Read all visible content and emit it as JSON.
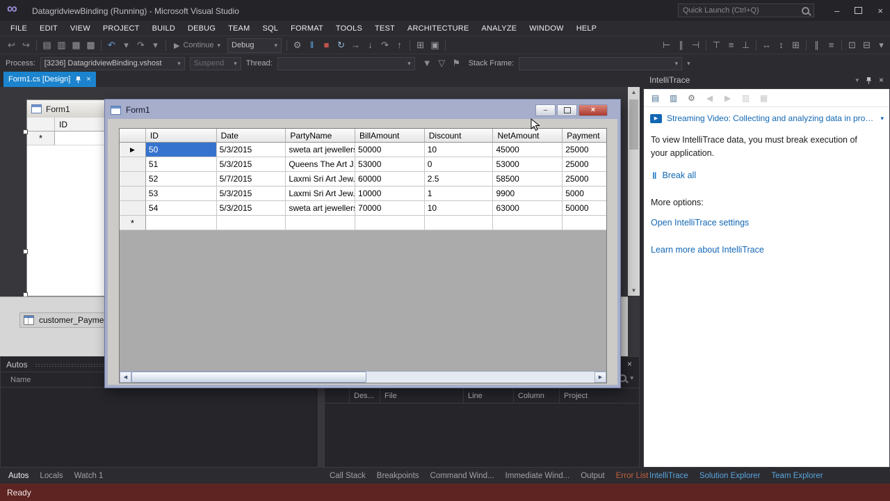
{
  "titlebar": {
    "app_title": "DatagridviewBinding (Running) - Microsoft Visual Studio",
    "quick_launch_placeholder": "Quick Launch (Ctrl+Q)"
  },
  "menu": {
    "items": [
      "FILE",
      "EDIT",
      "VIEW",
      "PROJECT",
      "BUILD",
      "DEBUG",
      "TEAM",
      "SQL",
      "FORMAT",
      "TOOLS",
      "TEST",
      "ARCHITECTURE",
      "ANALYZE",
      "WINDOW",
      "HELP"
    ]
  },
  "toolbar": {
    "continue_label": "Continue",
    "debug_combo_value": "Debug",
    "icons_left": [
      {
        "name": "nav-backward-icon",
        "glyph": "↩",
        "color": "#8A8A90"
      },
      {
        "name": "nav-forward-icon",
        "glyph": "↪",
        "color": "#8A8A90"
      },
      {
        "name": "toolbar-separator",
        "sep": true
      },
      {
        "name": "new-file-icon",
        "glyph": "▤",
        "color": "#9A9AA0"
      },
      {
        "name": "open-file-icon",
        "glyph": "▥",
        "color": "#9A9AA0"
      },
      {
        "name": "save-icon",
        "glyph": "▦",
        "color": "#9A9AA0"
      },
      {
        "name": "save-all-icon",
        "glyph": "▩",
        "color": "#9A9AA0"
      },
      {
        "name": "toolbar-separator",
        "sep": true
      },
      {
        "name": "undo-icon",
        "glyph": "↶",
        "color": "#67A0D8"
      },
      {
        "name": "chevron-down-icon",
        "glyph": "▾",
        "color": "#8E8E93"
      },
      {
        "name": "redo-icon",
        "glyph": "↷",
        "color": "#8A8A90"
      },
      {
        "name": "chevron-down-icon",
        "glyph": "▾",
        "color": "#8E8E93"
      },
      {
        "name": "toolbar-separator",
        "sep": true
      }
    ],
    "icons_debug": [
      {
        "name": "toolbar-separator",
        "sep": true
      },
      {
        "name": "debug-properties-icon",
        "glyph": "⚙",
        "color": "#9A9AA0"
      },
      {
        "name": "break-all-icon",
        "glyph": "‖",
        "color": "#5FA8E0"
      },
      {
        "name": "stop-debugging-icon",
        "glyph": "■",
        "color": "#C0524E"
      },
      {
        "name": "restart-icon",
        "glyph": "↻",
        "color": "#8FB8D8"
      },
      {
        "name": "show-next-statement-icon",
        "glyph": "→",
        "color": "#9A9AA0"
      },
      {
        "name": "step-into-icon",
        "glyph": "↓",
        "color": "#9A9AA0"
      },
      {
        "name": "step-over-icon",
        "glyph": "↷",
        "color": "#9A9AA0"
      },
      {
        "name": "step-out-icon",
        "glyph": "↑",
        "color": "#9A9AA0"
      },
      {
        "name": "toolbar-separator",
        "sep": true
      },
      {
        "name": "hex-display-icon",
        "glyph": "⊞",
        "color": "#9A9AA0"
      },
      {
        "name": "output-window-icon",
        "glyph": "▣",
        "color": "#9A9AA0"
      },
      {
        "name": "toolbar-separator",
        "sep": true
      }
    ],
    "icons_format": [
      {
        "name": "align-lefts-icon",
        "glyph": "⊢",
        "color": "#9A9AA0"
      },
      {
        "name": "align-centers-icon",
        "glyph": "∥",
        "color": "#9A9AA0"
      },
      {
        "name": "align-rights-icon",
        "glyph": "⊣",
        "color": "#9A9AA0"
      },
      {
        "name": "toolbar-separator",
        "sep": true
      },
      {
        "name": "align-tops-icon",
        "glyph": "⊤",
        "color": "#9A9AA0"
      },
      {
        "name": "align-middles-icon",
        "glyph": "≡",
        "color": "#9A9AA0"
      },
      {
        "name": "align-bottoms-icon",
        "glyph": "⊥",
        "color": "#9A9AA0"
      },
      {
        "name": "toolbar-separator",
        "sep": true
      },
      {
        "name": "make-same-width-icon",
        "glyph": "↔",
        "color": "#9A9AA0"
      },
      {
        "name": "make-same-height-icon",
        "glyph": "↕",
        "color": "#9A9AA0"
      },
      {
        "name": "make-same-size-icon",
        "glyph": "⊞",
        "color": "#9A9AA0"
      },
      {
        "name": "toolbar-separator",
        "sep": true
      },
      {
        "name": "horizontal-spacing-icon",
        "glyph": "∥",
        "color": "#9A9AA0"
      },
      {
        "name": "vertical-spacing-icon",
        "glyph": "≡",
        "color": "#9A9AA0"
      },
      {
        "name": "toolbar-separator",
        "sep": true
      },
      {
        "name": "bring-to-front-icon",
        "glyph": "⊡",
        "color": "#9A9AA0"
      },
      {
        "name": "send-to-back-icon",
        "glyph": "⊟",
        "color": "#9A9AA0"
      },
      {
        "name": "toolbar-overflow-icon",
        "glyph": "▾",
        "color": "#9A9AA0"
      }
    ]
  },
  "process_bar": {
    "process_label": "Process:",
    "process_value": "[3236] DatagridviewBinding.vshost",
    "suspend_label": "Suspend",
    "thread_label": "Thread:",
    "stack_frame_label": "Stack Frame:",
    "icons": [
      {
        "name": "filter-threads-icon",
        "glyph": "▼",
        "color": "#8E8E93"
      },
      {
        "name": "filter-frames-icon",
        "glyph": "▽",
        "color": "#8E8E93"
      },
      {
        "name": "flag-threads-icon",
        "glyph": "⚑",
        "color": "#8E8E93"
      }
    ]
  },
  "document_tab": {
    "label": "Form1.cs [Design]"
  },
  "designer": {
    "form_title": "Form1",
    "grid_column": "ID",
    "new_row_marker": "*",
    "component_tray_item": "customer_Payment"
  },
  "app_window": {
    "title": "Form1",
    "grid": {
      "columns": [
        "ID",
        "Date",
        "PartyName",
        "BillAmount",
        "Discount",
        "NetAmount",
        "Payment"
      ],
      "rows": [
        [
          "50",
          "5/3/2015",
          "sweta art jewellers",
          "50000",
          "10",
          "45000",
          "25000"
        ],
        [
          "51",
          "5/3/2015",
          "Queens The Art J...",
          "53000",
          "0",
          "53000",
          "25000"
        ],
        [
          "52",
          "5/7/2015",
          "Laxmi Sri Art Jew...",
          "60000",
          "2.5",
          "58500",
          "25000"
        ],
        [
          "53",
          "5/3/2015",
          "Laxmi Sri Art Jew...",
          "10000",
          "1",
          "9900",
          "5000"
        ],
        [
          "54",
          "5/3/2015",
          "sweta art jewellers",
          "70000",
          "10",
          "63000",
          "50000"
        ]
      ],
      "current_row_marker": "▶",
      "new_row_marker": "*",
      "selected_cell": {
        "row": 0,
        "col": 0
      }
    }
  },
  "intellitrace": {
    "title": "IntelliTrace",
    "toolbar_icons": [
      {
        "name": "it-events-view-icon",
        "glyph": "▤",
        "color": "#4A6E91"
      },
      {
        "name": "it-calls-view-icon",
        "glyph": "▥",
        "color": "#4A6E91"
      },
      {
        "name": "it-settings-gear-icon",
        "glyph": "⚙",
        "color": "#6E6E6E"
      },
      {
        "name": "it-prev-event-icon",
        "glyph": "◀",
        "color": "#C8C8C8"
      },
      {
        "name": "it-next-event-icon",
        "glyph": "▶",
        "color": "#C8C8C8"
      },
      {
        "name": "it-open-log-icon",
        "glyph": "▥",
        "color": "#C8C8C8"
      },
      {
        "name": "it-save-log-icon",
        "glyph": "▦",
        "color": "#C8C8C8"
      }
    ],
    "video_link": "Streaming Video: Collecting and analyzing data in product",
    "info_text": "To view IntelliTrace data, you must break execution of your application.",
    "break_all_label": "Break all",
    "more_options_label": "More options:",
    "open_settings_link": "Open IntelliTrace settings",
    "learn_more_link": "Learn more about IntelliTrace"
  },
  "autos": {
    "title": "Autos",
    "columns": [
      "Name"
    ]
  },
  "error_list": {
    "columns": [
      "Des...",
      "File",
      "Line",
      "Column",
      "Project"
    ]
  },
  "bottom_tabs": {
    "left": [
      {
        "label": "Autos",
        "state": "active"
      },
      {
        "label": "Locals"
      },
      {
        "label": "Watch 1"
      }
    ],
    "middle": [
      {
        "label": "Call Stack"
      },
      {
        "label": "Breakpoints"
      },
      {
        "label": "Command Wind..."
      },
      {
        "label": "Immediate Wind..."
      },
      {
        "label": "Output"
      },
      {
        "label": "Error List",
        "state": "error"
      }
    ],
    "right": [
      {
        "label": "IntelliTrace",
        "state": "link"
      },
      {
        "label": "Solution Explorer",
        "state": "link"
      },
      {
        "label": "Team Explorer",
        "state": "link"
      }
    ]
  },
  "status_bar": {
    "text": "Ready"
  },
  "glyphs": {
    "chevron_down": "▾",
    "close": "×",
    "minimize": "–",
    "infinity_logo": "∞",
    "up": "▲",
    "down": "▼",
    "left": "◀",
    "right": "▶",
    "play": "▶",
    "pause": "‖"
  },
  "colors": {
    "accent_tab": "#1C84CE",
    "selection_blue": "#3673CE",
    "status_running": "#5E2422",
    "link_blue": "#1267B4",
    "close_button_red": "#A93B30",
    "form_frame": "#A6AECB"
  }
}
